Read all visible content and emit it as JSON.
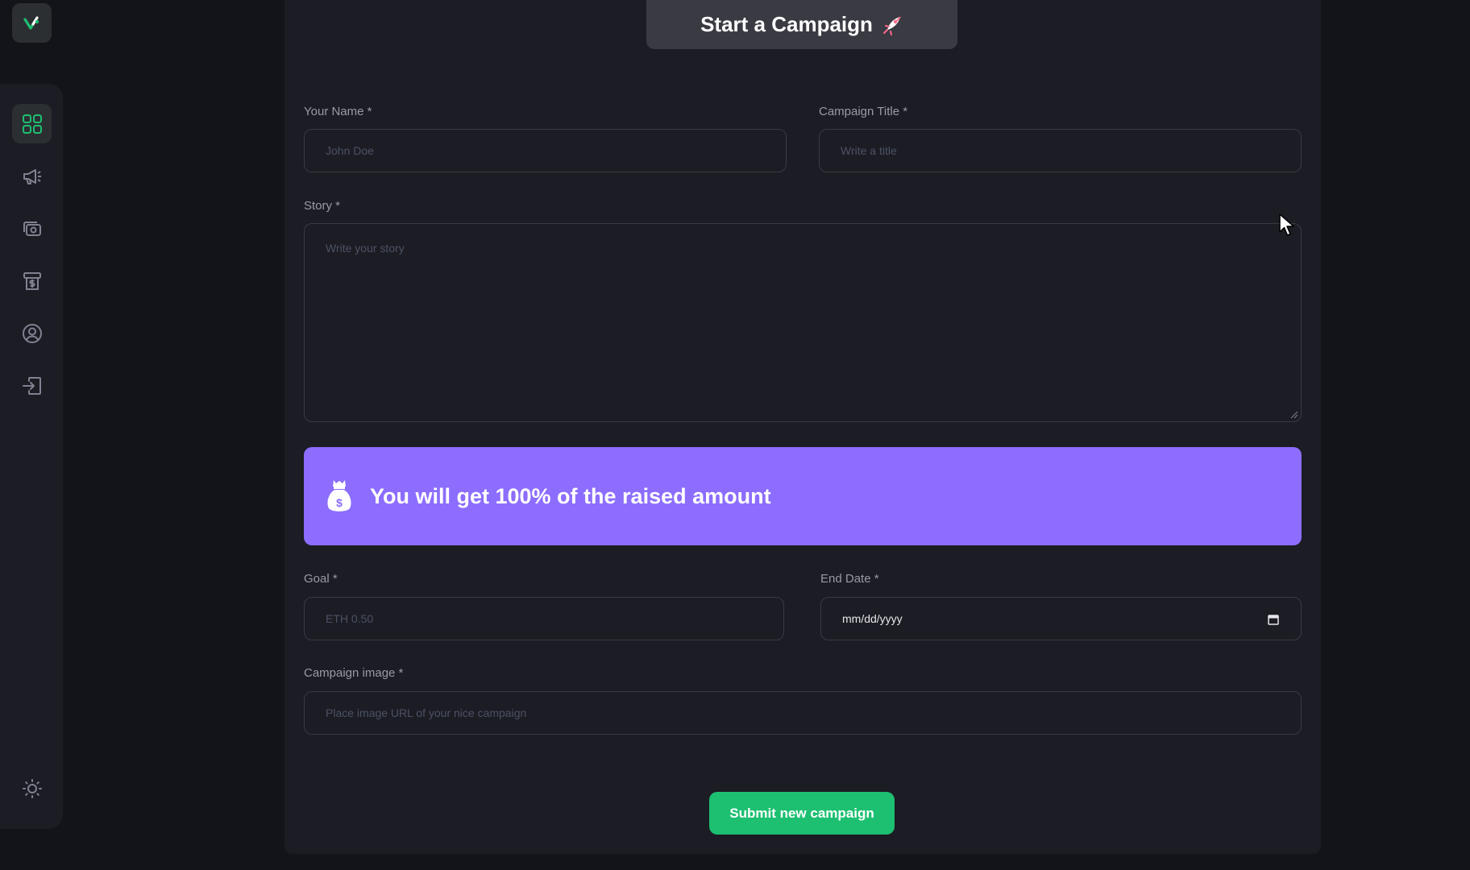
{
  "page": {
    "title": "Start a Campaign",
    "title_icon": "rocket-icon"
  },
  "sidebar": {
    "logo_icon": "logo-icon",
    "items": [
      {
        "name": "dashboard",
        "icon": "dashboard-grid-icon",
        "active": true
      },
      {
        "name": "campaign",
        "icon": "megaphone-icon",
        "active": false
      },
      {
        "name": "payment",
        "icon": "payment-icon",
        "active": false
      },
      {
        "name": "withdraw",
        "icon": "withdraw-icon",
        "active": false
      },
      {
        "name": "profile",
        "icon": "profile-icon",
        "active": false
      },
      {
        "name": "logout",
        "icon": "logout-icon",
        "active": false
      }
    ],
    "theme_icon": "sun-icon"
  },
  "form": {
    "name_label": "Your Name *",
    "name_placeholder": "John Doe",
    "title_label": "Campaign Title *",
    "title_placeholder": "Write a title",
    "story_label": "Story *",
    "story_placeholder": "Write your story",
    "banner_text": "You will get 100% of the raised amount",
    "banner_icon": "money-bag-icon",
    "goal_label": "Goal *",
    "goal_placeholder": "ETH 0.50",
    "end_date_label": "End Date *",
    "end_date_value": "mm/dd/yyyy",
    "image_label": "Campaign image *",
    "image_placeholder": "Place image URL of your nice campaign",
    "submit_label": "Submit new campaign"
  },
  "colors": {
    "background": "#13131a",
    "panel": "#1c1c24",
    "accent_green": "#1dc071",
    "banner_purple": "#8c6dfd"
  }
}
